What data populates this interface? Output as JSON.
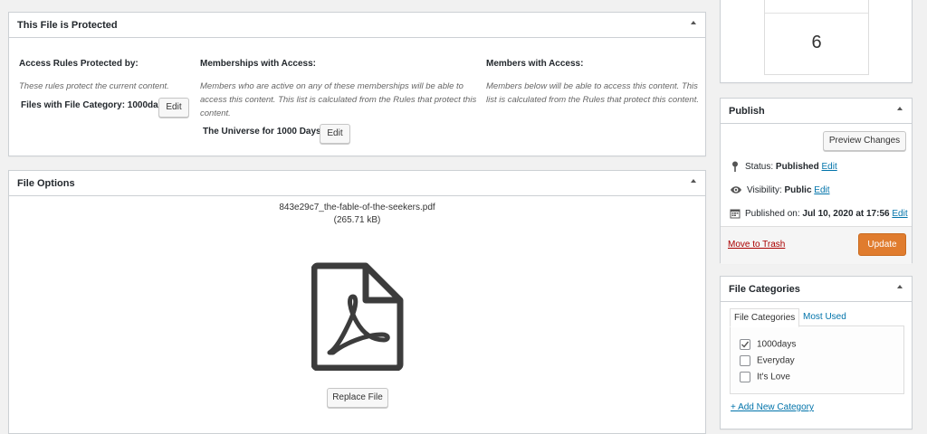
{
  "protected_box": {
    "title": "This File is Protected",
    "access_rules": {
      "heading": "Access Rules Protected by:",
      "description": "These rules protect the current content.",
      "value": "Files with File Category: 1000days",
      "edit_label": "Edit"
    },
    "memberships": {
      "heading": "Memberships with Access:",
      "description": "Members who are active on any of these memberships will be able to access this content. This list is calculated from the Rules that protect this content.",
      "value": "The Universe for 1000 Days",
      "edit_label": "Edit"
    },
    "members": {
      "heading": "Members with Access:",
      "description": "Members below will be able to access this content. This list is calculated from the Rules that protect this content."
    }
  },
  "file_options": {
    "title": "File Options",
    "filename": "843e29c7_the-fable-of-the-seekers.pdf",
    "filesize": "(265.71 kB)",
    "file_icon": "pdf-file-icon",
    "replace_label": "Replace File"
  },
  "counter_box": {
    "value": "6"
  },
  "publish": {
    "title": "Publish",
    "preview_label": "Preview Changes",
    "status_label": "Status:",
    "status_value": "Published",
    "visibility_label": "Visibility:",
    "visibility_value": "Public",
    "published_label": "Published on:",
    "published_value": "Jul 10, 2020 at 17:56",
    "edit_link": "Edit",
    "trash_label": "Move to Trash",
    "update_label": "Update",
    "update_color": "#e07c2e"
  },
  "categories": {
    "title": "File Categories",
    "tabs": [
      "File Categories",
      "Most Used"
    ],
    "items": [
      {
        "label": "1000days",
        "checked": true
      },
      {
        "label": "Everyday",
        "checked": false
      },
      {
        "label": "It's Love",
        "checked": false
      }
    ],
    "add_new_label": "+ Add New Category"
  }
}
